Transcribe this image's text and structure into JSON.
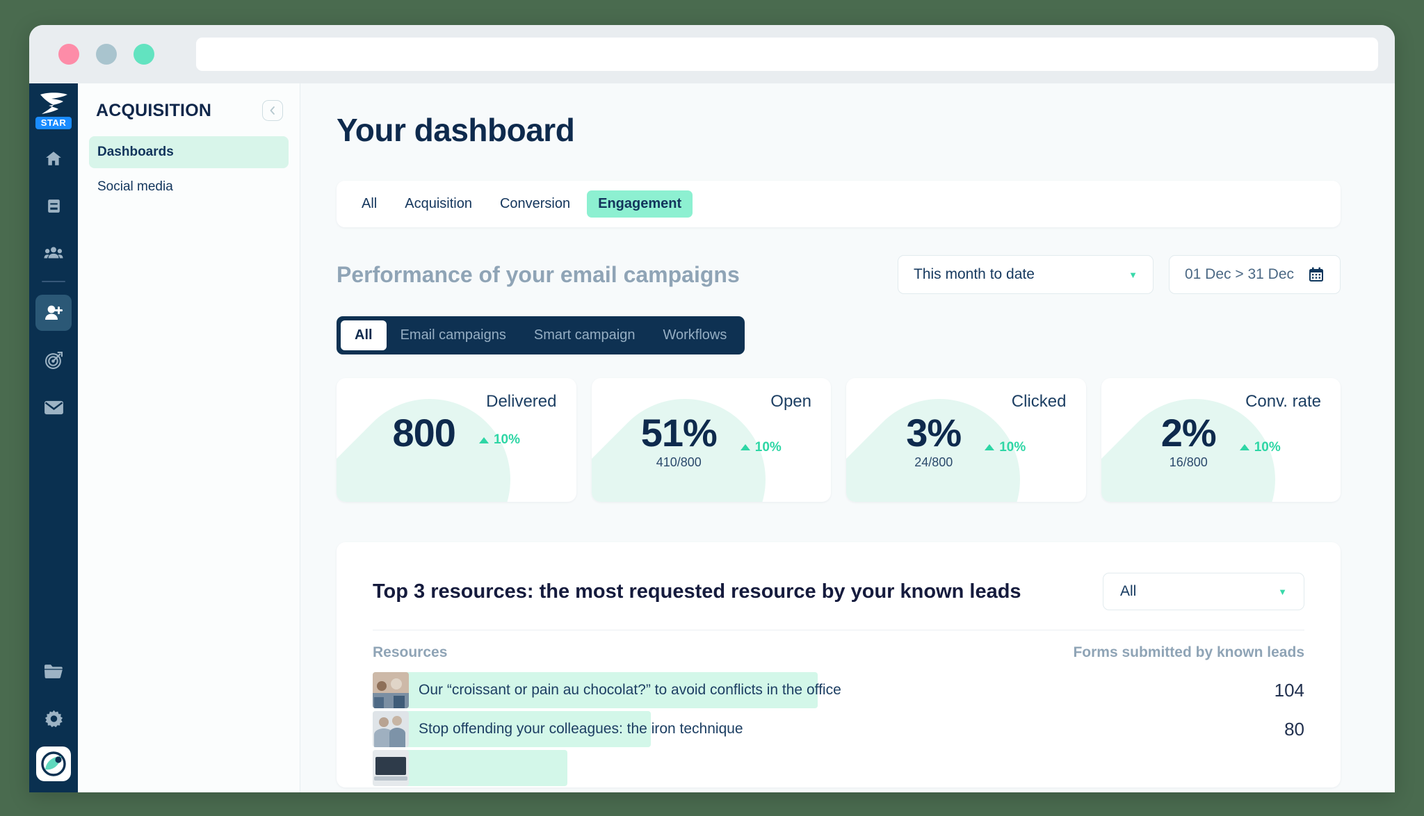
{
  "window": {
    "dots": [
      "close",
      "minimize",
      "maximize"
    ],
    "url_value": "",
    "url_placeholder": ""
  },
  "rail": {
    "brand_name": "brand-logo",
    "badge": "STAR",
    "icons": [
      {
        "name": "home-icon",
        "glyph": "home"
      },
      {
        "name": "book-icon",
        "glyph": "book"
      },
      {
        "name": "contacts-icon",
        "glyph": "contacts"
      },
      {
        "name": "add-contact-icon",
        "glyph": "add-contact",
        "active": true
      },
      {
        "name": "target-icon",
        "glyph": "target"
      },
      {
        "name": "mail-icon",
        "glyph": "mail"
      }
    ],
    "bottom_icons": [
      {
        "name": "folder-icon",
        "glyph": "folder"
      },
      {
        "name": "gear-icon",
        "glyph": "gear"
      }
    ]
  },
  "sidebar": {
    "title": "ACQUISITION",
    "collapse_label": "collapse",
    "items": [
      {
        "label": "Dashboards",
        "active": true
      },
      {
        "label": "Social media",
        "active": false
      }
    ]
  },
  "main": {
    "page_title": "Your dashboard",
    "tabs": [
      {
        "label": "All",
        "active": false
      },
      {
        "label": "Acquisition",
        "active": false
      },
      {
        "label": "Conversion",
        "active": false
      },
      {
        "label": "Engagement",
        "active": true
      }
    ],
    "section_title": "Performance of your email campaigns",
    "period_select": "This month to date",
    "date_range": "01 Dec > 31 Dec",
    "segments": [
      {
        "label": "All",
        "active": true
      },
      {
        "label": "Email campaigns",
        "active": false
      },
      {
        "label": "Smart campaign",
        "active": false
      },
      {
        "label": "Workflows",
        "active": false
      }
    ],
    "kpis": [
      {
        "label": "Delivered",
        "value": "800",
        "sub": "",
        "delta": "10%"
      },
      {
        "label": "Open",
        "value": "51%",
        "sub": "410/800",
        "delta": "10%"
      },
      {
        "label": "Clicked",
        "value": "3%",
        "sub": "24/800",
        "delta": "10%"
      },
      {
        "label": "Conv. rate",
        "value": "2%",
        "sub": "16/800",
        "delta": "10%"
      }
    ],
    "resources": {
      "title": "Top 3 resources: the most requested resource by your known leads",
      "filter": "All",
      "col_resource": "Resources",
      "col_count": "Forms submitted by known leads",
      "rows": [
        {
          "name": "Our “croissant or pain au chocolat?” to avoid conflicts in the office",
          "count": "104",
          "bar_pct": 100
        },
        {
          "name": "Stop offending your colleagues: the iron technique",
          "count": "80",
          "bar_pct": 62
        },
        {
          "name": "",
          "count": "",
          "bar_pct": 44
        }
      ]
    }
  },
  "colors": {
    "navy": "#0e2a4d",
    "rail": "#0a3050",
    "mint": "#8df0d1",
    "mint_light": "#d3f7e9",
    "accent_green": "#2ed6a5",
    "muted": "#8fa4b6"
  }
}
